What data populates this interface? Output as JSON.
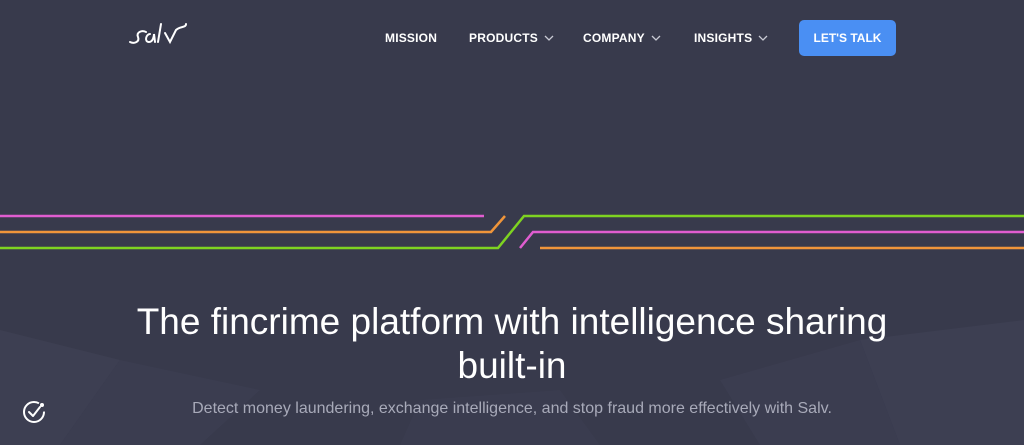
{
  "brand": {
    "logo_text": "salv"
  },
  "nav": {
    "items": [
      {
        "label": "MISSION",
        "has_dropdown": false
      },
      {
        "label": "PRODUCTS",
        "has_dropdown": true
      },
      {
        "label": "COMPANY",
        "has_dropdown": true
      },
      {
        "label": "INSIGHTS",
        "has_dropdown": true
      }
    ],
    "cta_label": "LET'S TALK"
  },
  "hero": {
    "title": "The fincrime platform with intelligence sharing built-in",
    "subtitle": "Detect money laundering, exchange intelligence, and stop fraud more effectively with Salv."
  },
  "colors": {
    "background": "#383a4c",
    "accent": "#4a8ff3",
    "line_pink": "#e05dd0",
    "line_orange": "#f0953a",
    "line_green": "#7ed321"
  },
  "icons": {
    "dropdown": "chevron-down-icon",
    "badge": "checkmark-badge-icon"
  }
}
